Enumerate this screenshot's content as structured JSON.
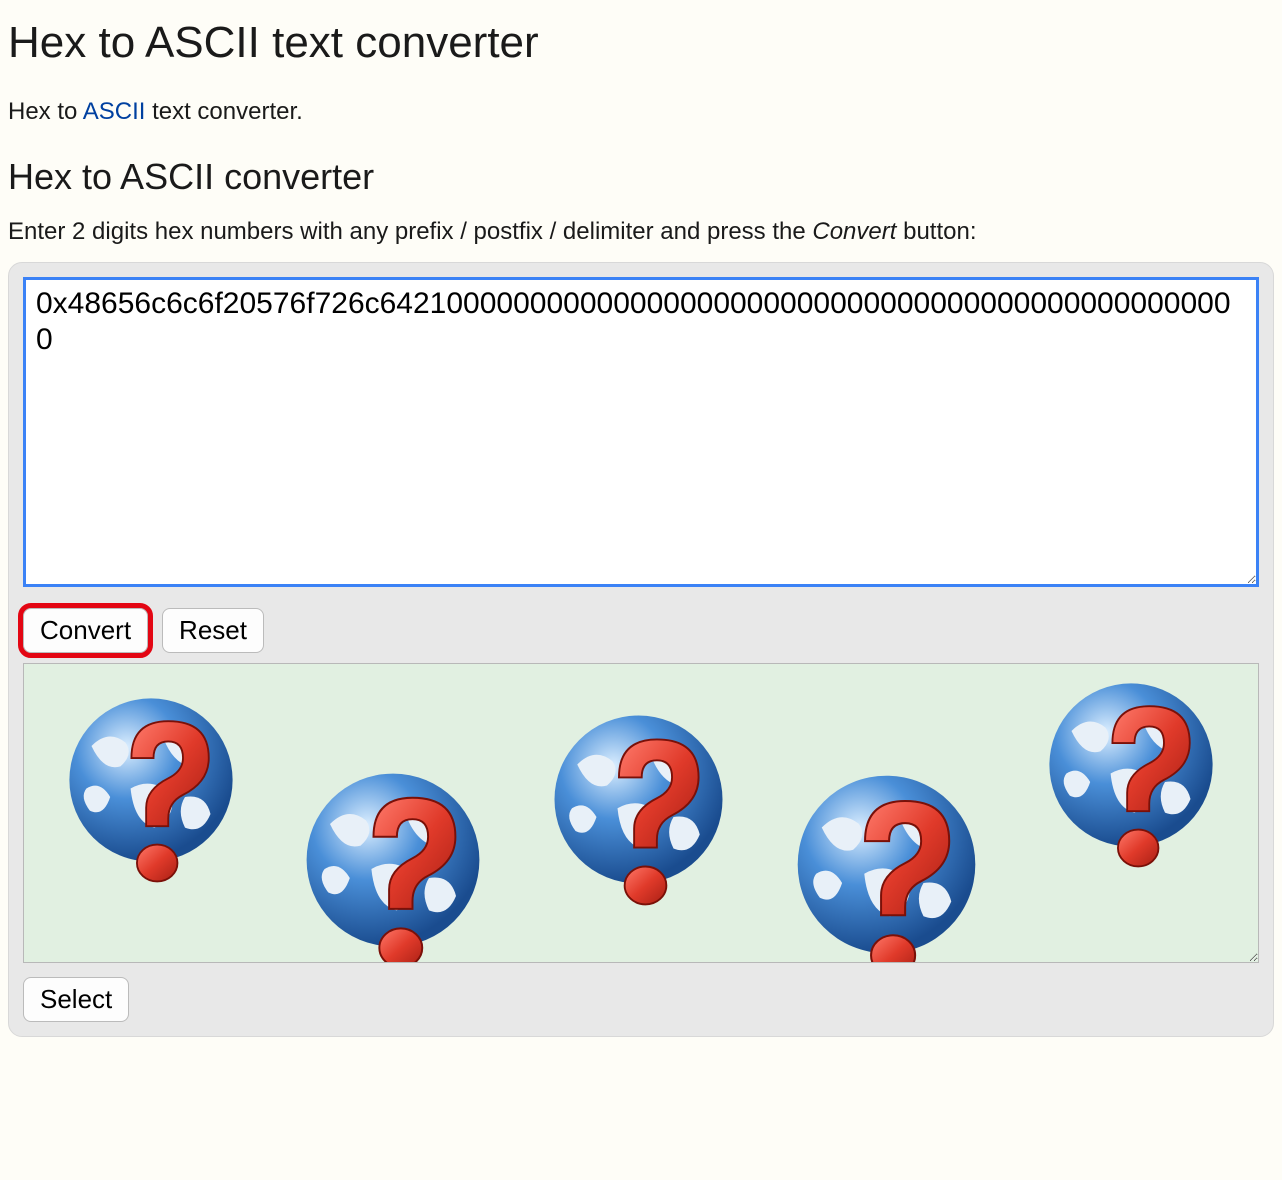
{
  "headings": {
    "page_title": "Hex to ASCII text converter",
    "section_title": "Hex to ASCII converter"
  },
  "intro": {
    "prefix": "Hex to ",
    "link_text": "ASCII",
    "suffix": " text converter."
  },
  "instructions": {
    "prefix": "Enter 2 digits hex numbers with any prefix / postfix / delimiter and press the ",
    "convert_word": "Convert",
    "suffix": " button:"
  },
  "inputs": {
    "hex_value": "0x48656c6c6f20576f726c6421000000000000000000000000000000000000000000000000"
  },
  "buttons": {
    "convert": "Convert",
    "reset": "Reset",
    "select": "Select"
  },
  "output": {
    "placeholder_globe_count": 5
  }
}
